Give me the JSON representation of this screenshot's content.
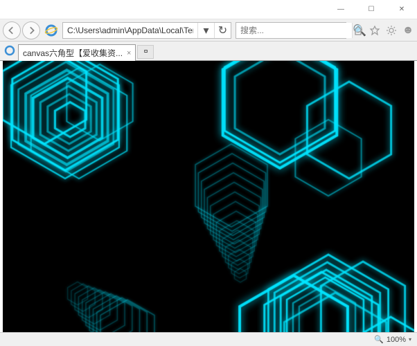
{
  "window": {
    "min": "—",
    "max": "☐",
    "close": "✕"
  },
  "nav": {
    "address": "C:\\Users\\admin\\AppData\\Local\\Temp",
    "search_placeholder": "搜索...",
    "refresh_glyph": "↻",
    "dropdown_glyph": "▾",
    "search_glyph": "🔍"
  },
  "tab": {
    "title": "canvas六角型【爱收集资...",
    "close": "×",
    "newtab": "▫"
  },
  "status": {
    "zoom_icon": "🔍",
    "zoom": "100%",
    "drop": "▾"
  },
  "colors": {
    "hex_glow": "#00e5ff",
    "hex_core": "#6ff6ff"
  }
}
